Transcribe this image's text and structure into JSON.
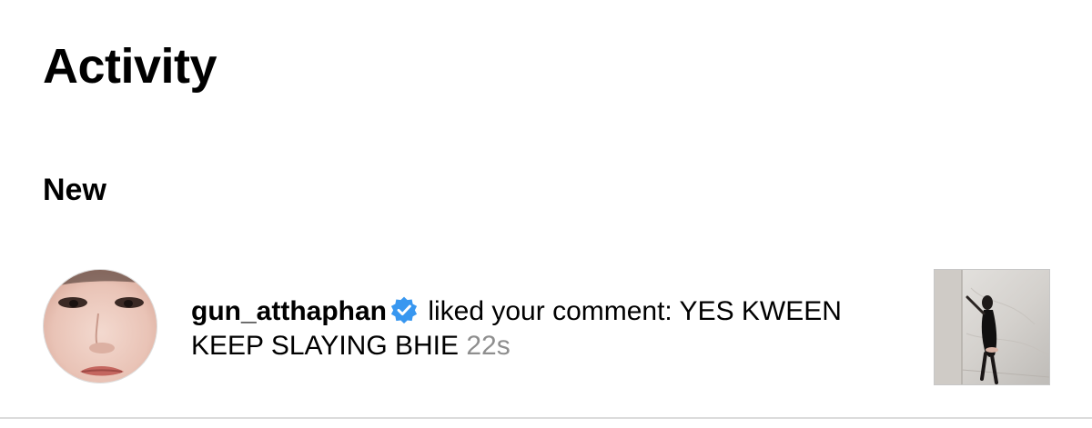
{
  "header": {
    "title": "Activity"
  },
  "section": {
    "heading": "New"
  },
  "notifications": [
    {
      "username": "gun_atthaphan",
      "verified": true,
      "action_text": " liked your comment: YES KWEEN KEEP SLAYING BHIE ",
      "timestamp": "22s",
      "avatar_icon": "user-avatar-photo",
      "thumbnail_icon": "post-thumbnail-photo"
    }
  ],
  "colors": {
    "text": "#000000",
    "timestamp": "#8e8e8e",
    "verified_badge": "#3897f0",
    "divider": "#dbdbdb",
    "background": "#ffffff"
  }
}
